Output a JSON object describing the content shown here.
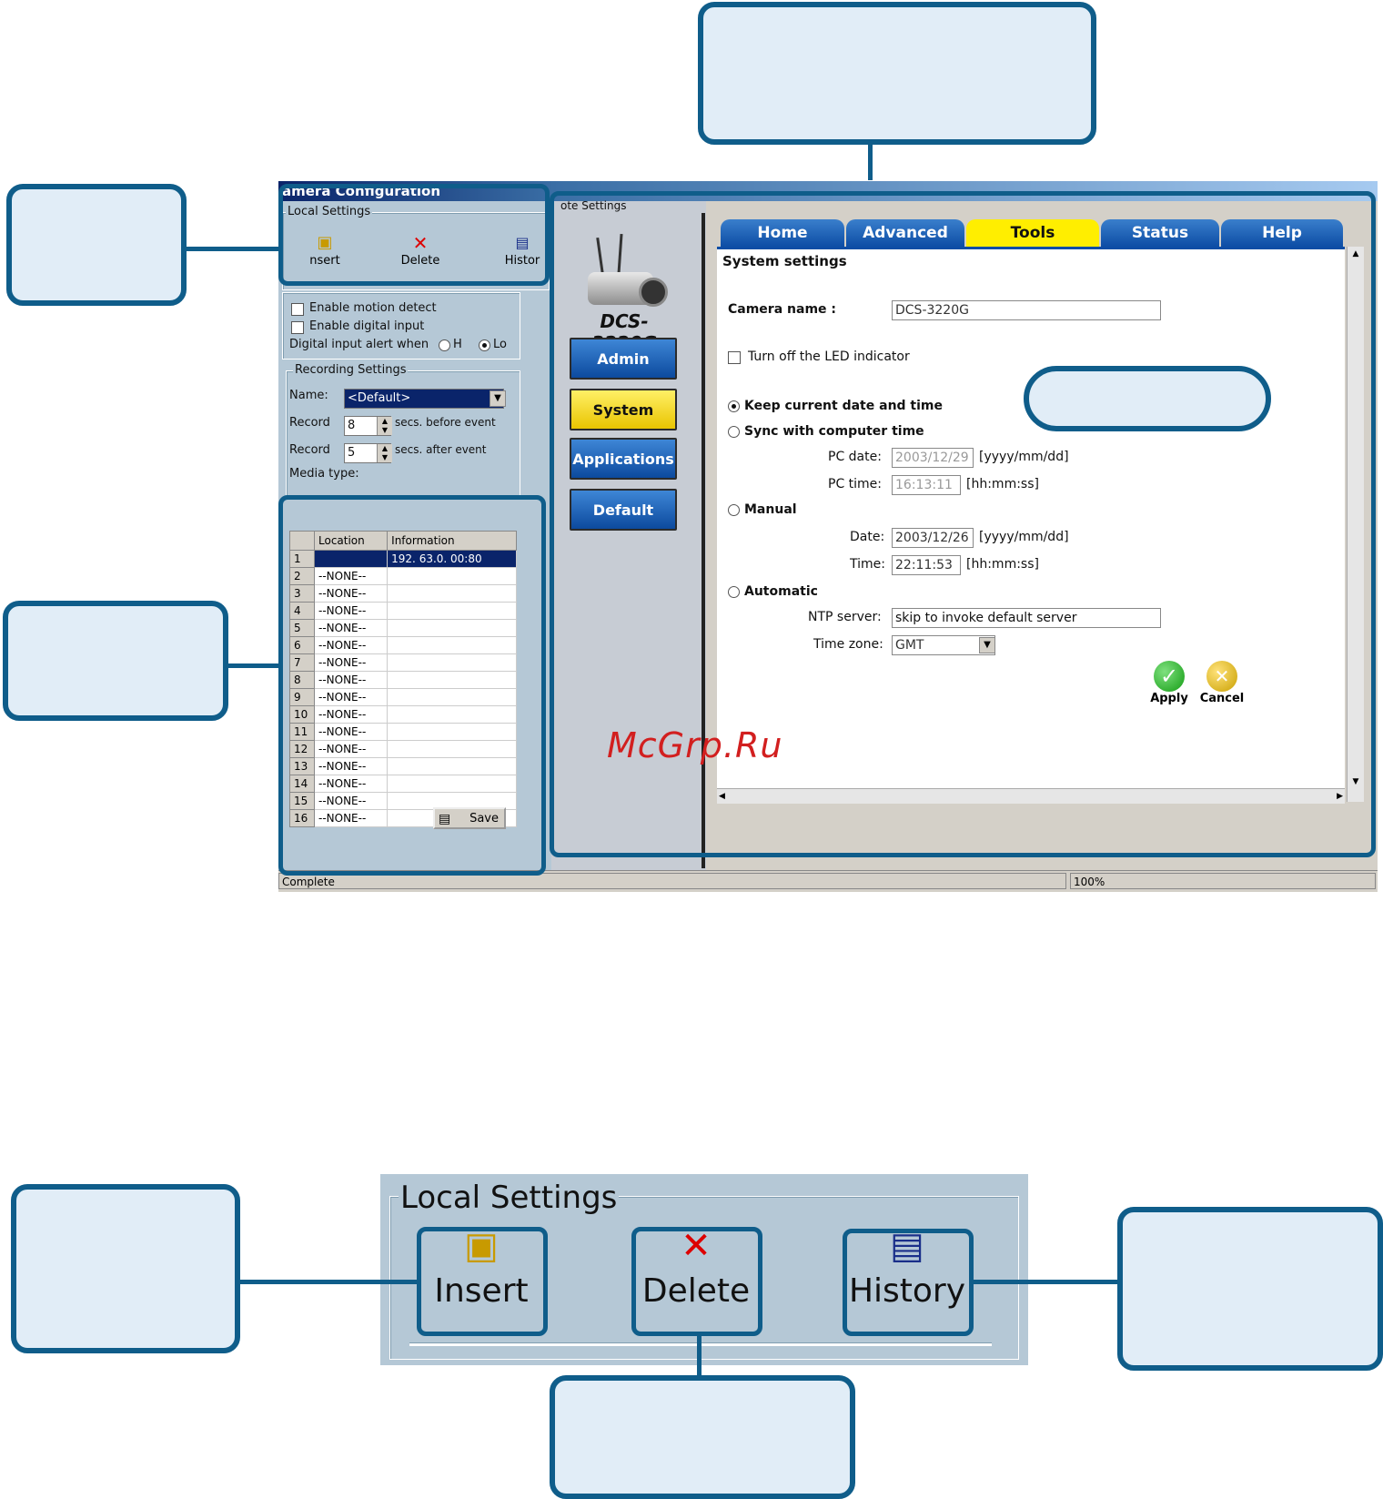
{
  "window": {
    "title": "amera Configuration",
    "remote_settings_label": "ote Settings",
    "status_left": "Complete",
    "status_right": "100%"
  },
  "local_settings": {
    "group_label": "Local Settings",
    "insert_label": "Insert",
    "delete_label": "Delete",
    "history_label": "History",
    "insert_label_small": "nsert",
    "delete_label_small": "Delete",
    "history_label_small": "Histor"
  },
  "motion": {
    "enable_motion": "Enable motion detect",
    "enable_digital": "Enable digital input",
    "digital_alert": "Digital input alert when",
    "high": "H",
    "low": "Lo"
  },
  "recording": {
    "group_label": "Recording Settings",
    "name_label": "Name:",
    "name_value": "<Default>",
    "record_label": "Record",
    "before_value": "8",
    "before_text": "secs. before event",
    "after_value": "5",
    "after_text": "secs. after event",
    "media_type": "Media type:"
  },
  "location_table": {
    "headers": [
      "Location",
      "Information"
    ],
    "rows": [
      {
        "n": "1",
        "loc": "",
        "info": "192. 63.0. 00:80"
      },
      {
        "n": "2",
        "loc": "--NONE--",
        "info": ""
      },
      {
        "n": "3",
        "loc": "--NONE--",
        "info": ""
      },
      {
        "n": "4",
        "loc": "--NONE--",
        "info": ""
      },
      {
        "n": "5",
        "loc": "--NONE--",
        "info": ""
      },
      {
        "n": "6",
        "loc": "--NONE--",
        "info": ""
      },
      {
        "n": "7",
        "loc": "--NONE--",
        "info": ""
      },
      {
        "n": "8",
        "loc": "--NONE--",
        "info": ""
      },
      {
        "n": "9",
        "loc": "--NONE--",
        "info": ""
      },
      {
        "n": "10",
        "loc": "--NONE--",
        "info": ""
      },
      {
        "n": "11",
        "loc": "--NONE--",
        "info": ""
      },
      {
        "n": "12",
        "loc": "--NONE--",
        "info": ""
      },
      {
        "n": "13",
        "loc": "--NONE--",
        "info": ""
      },
      {
        "n": "14",
        "loc": "--NONE--",
        "info": ""
      },
      {
        "n": "15",
        "loc": "--NONE--",
        "info": ""
      },
      {
        "n": "16",
        "loc": "--NONE--",
        "info": ""
      }
    ],
    "save_label": "Save"
  },
  "camera": {
    "model": "DCS-3220G",
    "nav": [
      "Admin",
      "System",
      "Applications",
      "Default"
    ]
  },
  "tabs": [
    "Home",
    "Advanced",
    "Tools",
    "Status",
    "Help"
  ],
  "system": {
    "heading": "System settings",
    "camera_name_label": "Camera name :",
    "camera_name_value": "DCS-3220G",
    "led_label": "Turn off the LED indicator",
    "keep_time": "Keep current date and time",
    "sync_time": "Sync with computer time",
    "pc_date_label": "PC date:",
    "pc_date_value": "2003/12/29",
    "date_format": "[yyyy/mm/dd]",
    "pc_time_label": "PC time:",
    "pc_time_value": "16:13:11",
    "time_format": "[hh:mm:ss]",
    "manual": "Manual",
    "date_label": "Date:",
    "date_value": "2003/12/26",
    "time_label": "Time:",
    "time_value": "22:11:53",
    "automatic": "Automatic",
    "ntp_label": "NTP server:",
    "ntp_value": "skip to invoke default server",
    "tz_label": "Time zone:",
    "tz_value": "GMT",
    "apply": "Apply",
    "cancel": "Cancel"
  },
  "watermark": "McGrp.Ru",
  "colors": {
    "callout_border": "#0f5d8a",
    "callout_fill": "#e1edf7",
    "tab_blue": "#0d4da5",
    "tab_active": "#ffee00"
  }
}
